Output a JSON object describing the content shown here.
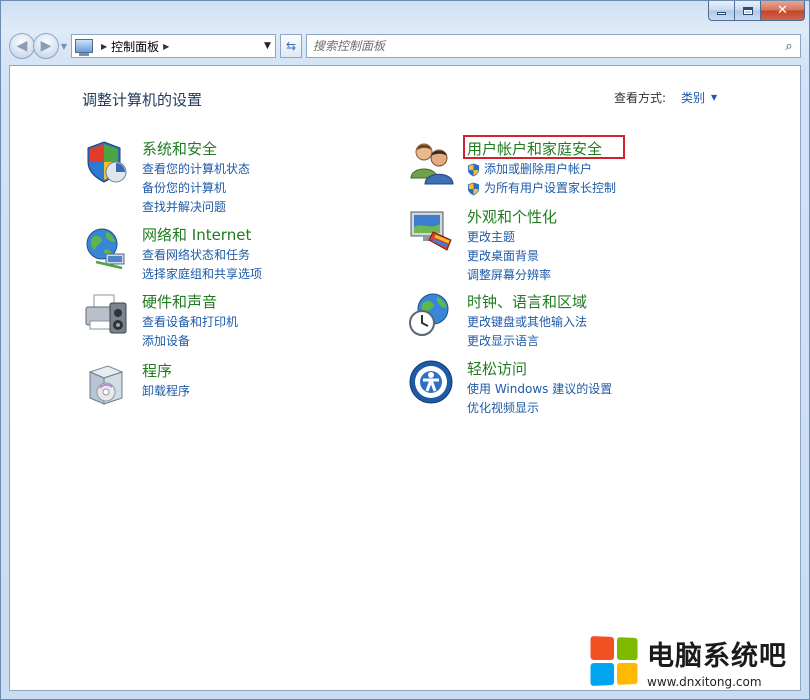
{
  "window": {
    "caption_buttons": {
      "minimize_icon": "minimize-icon",
      "maximize_icon": "maximize-icon",
      "close_label": "✕"
    }
  },
  "nav": {
    "back_icon": "back-arrow-icon",
    "forward_icon": "forward-arrow-icon",
    "breadcrumb": [
      "控制面板"
    ],
    "search_placeholder": "搜索控制面板"
  },
  "header": {
    "title": "调整计算机的设置",
    "view_by_label": "查看方式:",
    "view_by_value": "类别"
  },
  "categories": {
    "system": {
      "title": "系统和安全",
      "links": [
        "查看您的计算机状态",
        "备份您的计算机",
        "查找并解决问题"
      ]
    },
    "network": {
      "title": "网络和 Internet",
      "links": [
        "查看网络状态和任务",
        "选择家庭组和共享选项"
      ]
    },
    "hardware": {
      "title": "硬件和声音",
      "links": [
        "查看设备和打印机",
        "添加设备"
      ]
    },
    "programs": {
      "title": "程序",
      "links": [
        "卸载程序"
      ]
    },
    "users": {
      "title": "用户帐户和家庭安全",
      "links": [
        "添加或删除用户帐户",
        "为所有用户设置家长控制"
      ]
    },
    "appearance": {
      "title": "外观和个性化",
      "links": [
        "更改主题",
        "更改桌面背景",
        "调整屏幕分辨率"
      ]
    },
    "clock": {
      "title": "时钟、语言和区域",
      "links": [
        "更改键盘或其他输入法",
        "更改显示语言"
      ]
    },
    "ease": {
      "title": "轻松访问",
      "links": [
        "使用 Windows 建议的设置",
        "优化视频显示"
      ]
    }
  },
  "watermark": {
    "title": "电脑系统吧",
    "url": "www.dnxitong.com",
    "colors": [
      "#f25022",
      "#7fba00",
      "#00a4ef",
      "#ffb900"
    ]
  },
  "colors": {
    "category_title": "#217b21",
    "link": "#1e5aa8",
    "highlight": "#d3202e"
  }
}
